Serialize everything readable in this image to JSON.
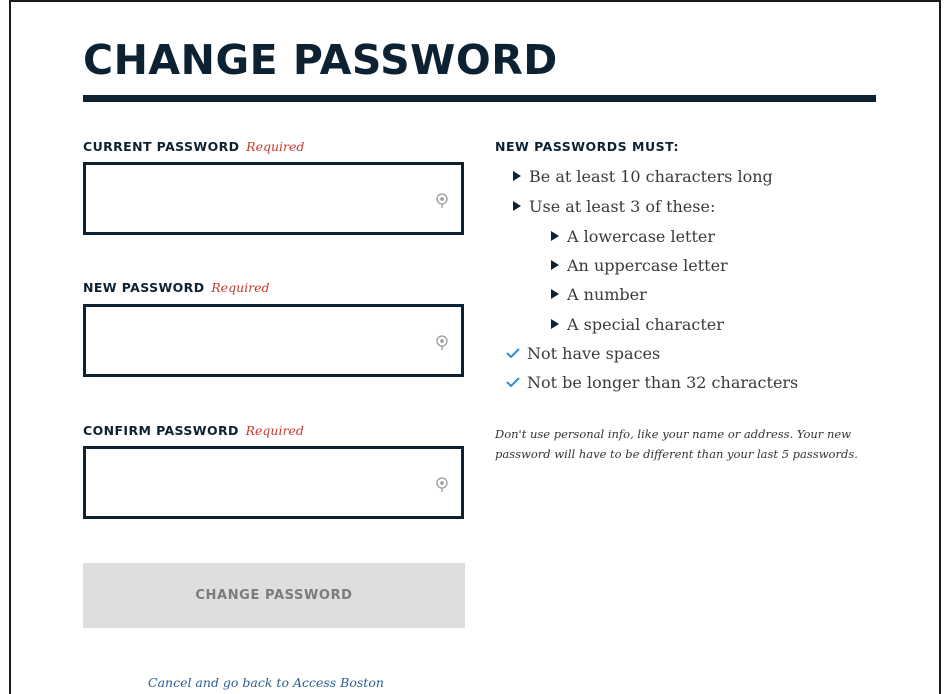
{
  "page": {
    "title": "CHANGE PASSWORD"
  },
  "form": {
    "current_label": "CURRENT PASSWORD",
    "new_label": "NEW PASSWORD",
    "confirm_label": "CONFIRM PASSWORD",
    "required_text": "Required",
    "current_value": "",
    "new_value": "",
    "confirm_value": "",
    "submit_label": "CHANGE PASSWORD",
    "cancel_link": "Cancel and go back to Access Boston"
  },
  "rules": {
    "heading": "NEW PASSWORDS MUST:",
    "items": [
      {
        "text": "Be at least 10 characters long",
        "icon": "triangle-bullet-icon"
      },
      {
        "text": "Use at least 3 of these:",
        "icon": "triangle-bullet-icon"
      },
      {
        "text": "A lowercase letter",
        "icon": "triangle-bullet-icon"
      },
      {
        "text": "An uppercase letter",
        "icon": "triangle-bullet-icon"
      },
      {
        "text": "A number",
        "icon": "triangle-bullet-icon"
      },
      {
        "text": "A special character",
        "icon": "triangle-bullet-icon"
      },
      {
        "text": "Not have spaces",
        "icon": "check-icon"
      },
      {
        "text": "Not be longer than 32 characters",
        "icon": "check-icon"
      }
    ],
    "note": "Don't use personal info, like your name or address. Your new password will have to be different than your last 5 passwords."
  },
  "colors": {
    "navy": "#0c2233",
    "required_red": "#c73a30",
    "check_blue": "#2f8bd6",
    "button_disabled": "#dedede",
    "link": "#2a5f8f"
  }
}
